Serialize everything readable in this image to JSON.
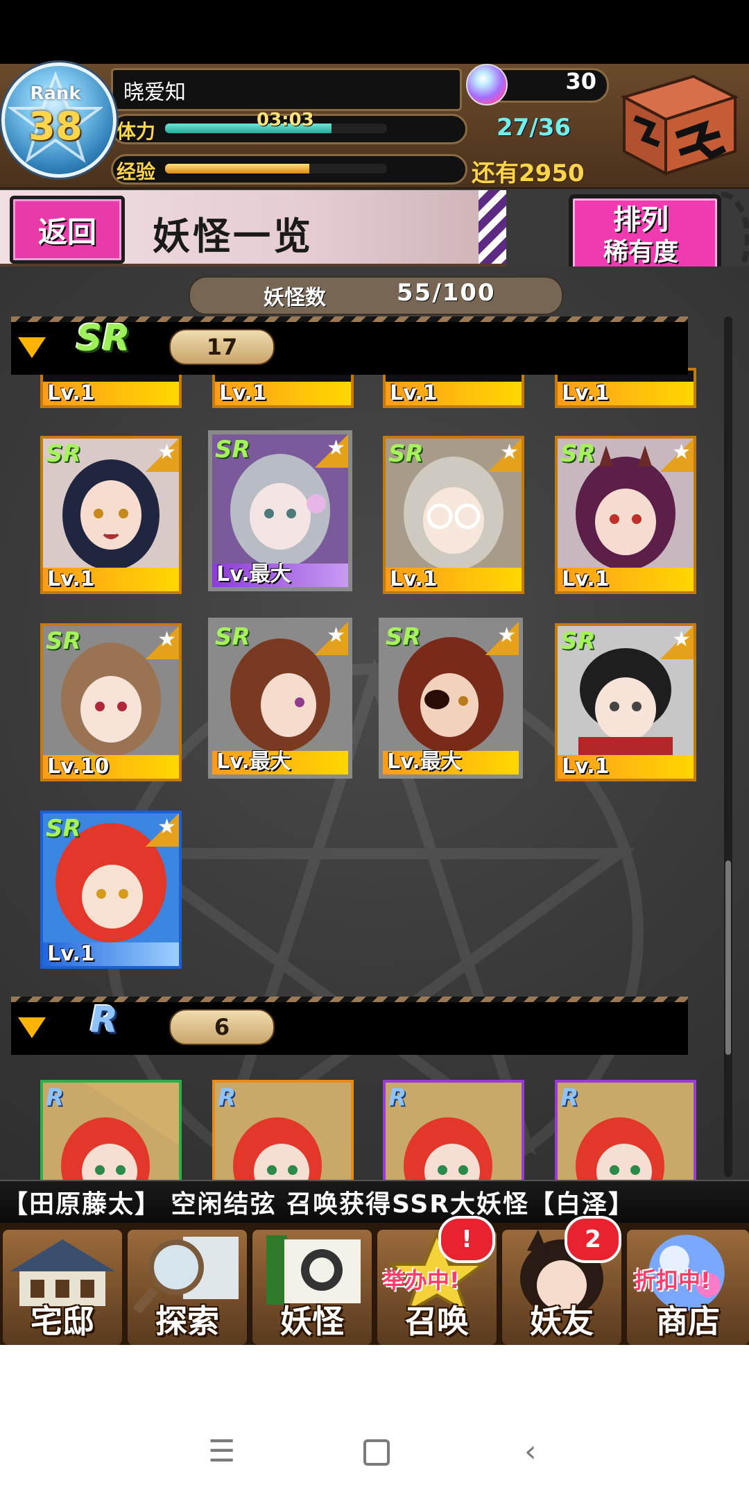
{
  "header": {
    "rank_label": "Rank",
    "rank": "38",
    "player_name": "晓爱知",
    "stamina_label": "体力",
    "stamina_timer": "03:03",
    "stamina_value": "27/36",
    "stamina_fill": 0.75,
    "exp_label": "经验",
    "exp_remaining": "还有2950",
    "exp_fill": 0.65,
    "gem_count": "30"
  },
  "titlebar": {
    "back_label": "返回",
    "title": "妖怪一览",
    "sort_label": "排列",
    "sort_value": "稀有度"
  },
  "summary": {
    "count_label": "妖怪数",
    "count_value": "55/100"
  },
  "sections": [
    {
      "rarity": "SR",
      "count": "17",
      "top_row_levels": [
        "Lv.1",
        "Lv.1",
        "Lv.1",
        "Lv.1"
      ],
      "cards": [
        {
          "badge": "SR",
          "level": "Lv.1"
        },
        {
          "badge": "SR",
          "level": "Lv.最大"
        },
        {
          "badge": "SR",
          "level": "Lv.1"
        },
        {
          "badge": "SR",
          "level": "Lv.1"
        },
        {
          "badge": "SR",
          "level": "Lv.10"
        },
        {
          "badge": "SR",
          "level": "Lv.最大"
        },
        {
          "badge": "SR",
          "level": "Lv.最大"
        },
        {
          "badge": "SR",
          "level": "Lv.1"
        },
        {
          "badge": "SR",
          "level": "Lv.1"
        }
      ]
    },
    {
      "rarity": "R",
      "count": "6",
      "cards": [
        {
          "badge": "R"
        },
        {
          "badge": "R"
        },
        {
          "badge": "R"
        },
        {
          "badge": "R"
        }
      ]
    }
  ],
  "ticker": {
    "text": "【田原藤太】  空闲结弦 召唤获得SSR大妖怪【白泽】"
  },
  "bottom_nav": [
    {
      "label": "宅邸"
    },
    {
      "label": "探索"
    },
    {
      "label": "妖怪"
    },
    {
      "label": "召唤",
      "tag": "举办中!",
      "badge": "!"
    },
    {
      "label": "妖友",
      "badge": "2"
    },
    {
      "label": "商店",
      "tag": "折扣中!"
    }
  ],
  "colors": {
    "accent_pink": "#ef3ab0",
    "sr_green": "#9ef05a",
    "r_blue": "#8fc3ff",
    "gold": "#ffd54a"
  }
}
